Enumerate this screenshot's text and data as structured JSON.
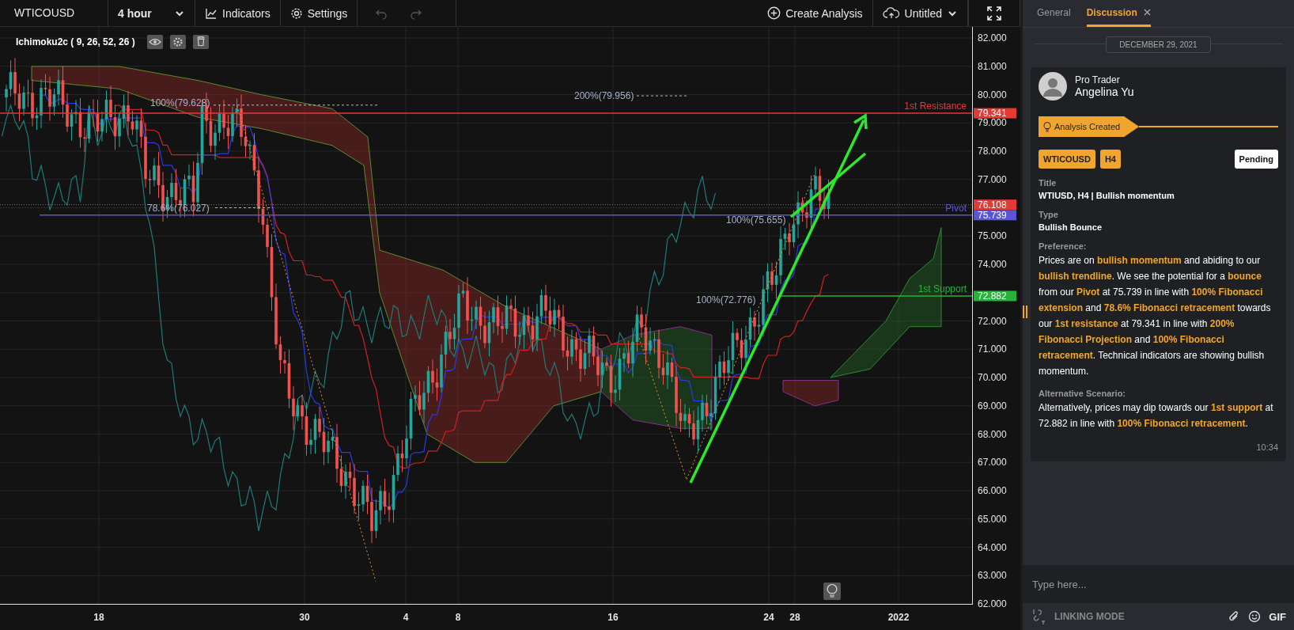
{
  "toolbar": {
    "symbol": "WTICOUSD",
    "timeframe": "4 hour",
    "buttons": [
      {
        "label": "Indicators",
        "kind": "indicators"
      },
      {
        "label": "Settings",
        "kind": "settings"
      }
    ],
    "undo_disabled": true,
    "redo_disabled": true,
    "create": "Create Analysis",
    "layout": "Untitled"
  },
  "chart": {
    "indicator": "Ichimoku2c ( 9, 26, 52, 26 )",
    "y_ticks": [
      "82.000",
      "81.000",
      "80.000",
      "79.000",
      "78.000",
      "77.000",
      "75.000",
      "74.000",
      "72.000",
      "71.000",
      "70.000",
      "69.000",
      "68.000",
      "67.000",
      "66.000",
      "65.000",
      "64.000",
      "63.000",
      "62.000"
    ],
    "x_ticks": [
      "18",
      "30",
      "4",
      "8",
      "16",
      "24",
      "28",
      "2022"
    ],
    "levels": [
      {
        "label": "1st Resistance",
        "price": "79.341",
        "kind": "resistance"
      },
      {
        "label": "Pivot",
        "price": "75.739",
        "kind": "pivot"
      },
      {
        "label": "1st Support",
        "price": "72.882",
        "kind": "support"
      }
    ],
    "last_price": "76.108",
    "fib_labels": [
      "100%(79.628)",
      "200%(79.956)",
      "78.6%(76.027)",
      "100%(75.655)",
      "100%(72.776)"
    ]
  },
  "panel": {
    "tabs": [
      {
        "label": "General",
        "selected": false,
        "closable": false
      },
      {
        "label": "Discussion",
        "selected": true,
        "closable": true
      }
    ],
    "date": "DECEMBER 29, 2021",
    "message": {
      "role": "Pro Trader",
      "author": "Angelina Yu",
      "event": "Analysis Created",
      "tags": [
        "WTICOUSD",
        "H4"
      ],
      "status": "Pending",
      "fields": [
        {
          "label": "Title",
          "value": "WTIUSD, H4 | Bullish momentum",
          "kind": "heading"
        },
        {
          "label": "Type",
          "value": "Bullish Bounce",
          "kind": "heading"
        },
        {
          "label": "Preference:",
          "value": "Prices are on **bullish momentum** and abiding to our **bullish trendline**. We see the potential for a **bounce** from our **Pivot** at 75.739 in line with **100% Fibonacci extension** and **78.6% Fibonacci retracement** towards our **1st resistance** at 79.341 in line with **200% Fibonacci Projection** and **100% Fibonacci retracement**. Technical indicators are showing bullish momentum.",
          "kind": "paragraph"
        },
        {
          "label": "Alternative Scenario:",
          "value": "Alternatively, prices may dip towards our **1st support** at 72.882 in line with **100% Fibonacci retracement**.",
          "kind": "paragraph"
        }
      ],
      "time": "10:34"
    },
    "composer": {
      "placeholder": "Type here..."
    },
    "footer": {
      "linking": "LINKING MODE",
      "gif": "GIF"
    }
  }
}
